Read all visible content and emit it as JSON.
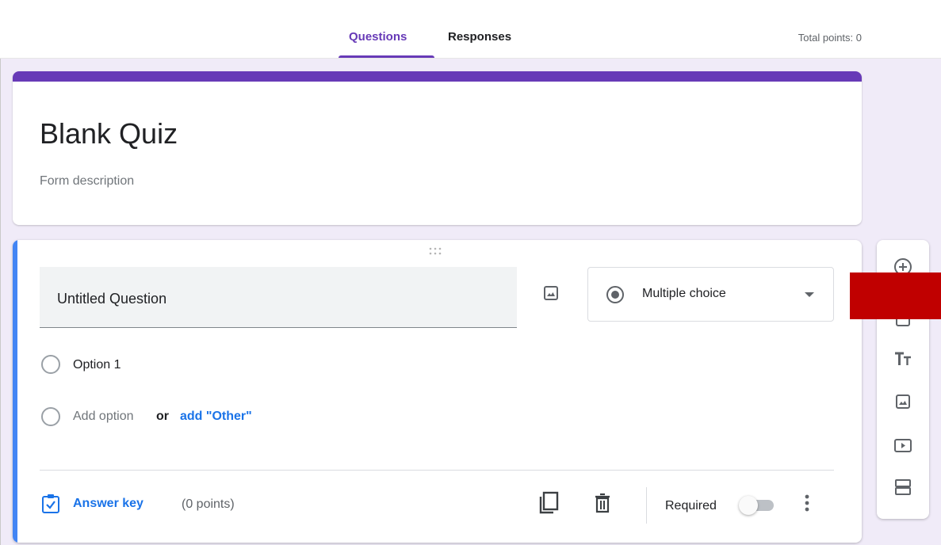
{
  "header": {
    "tabs": [
      {
        "label": "Questions",
        "active": true
      },
      {
        "label": "Responses",
        "active": false
      }
    ],
    "total_points": "Total points: 0"
  },
  "form": {
    "title": "Blank Quiz",
    "description_placeholder": "Form description",
    "accent_color": "#673ab7"
  },
  "question": {
    "title": "Untitled Question",
    "type": "Multiple choice",
    "options": [
      "Option 1"
    ],
    "add_option": "Add option",
    "or": "or",
    "add_other": "add \"Other\"",
    "answer_key": "Answer key",
    "points": "(0 points)",
    "required_label": "Required",
    "required": false
  },
  "side_toolbar": {
    "items": [
      "add-question-icon",
      "import-questions-icon",
      "add-title-icon",
      "add-image-icon",
      "add-video-icon",
      "add-section-icon"
    ]
  },
  "colors": {
    "accent": "#673ab7",
    "link": "#1a73e8",
    "active_card_bar": "#4285f4",
    "overlay_block": "#c00000"
  }
}
